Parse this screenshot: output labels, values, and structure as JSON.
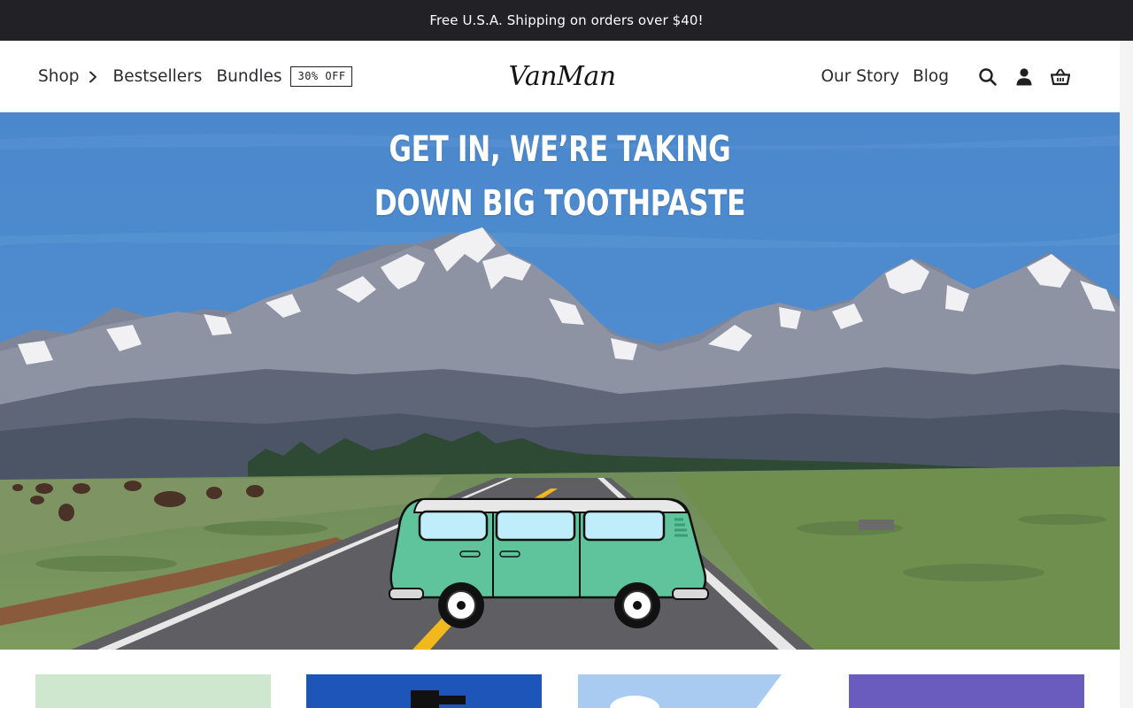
{
  "announcement": {
    "text": "Free U.S.A. Shipping on orders over $40!"
  },
  "header": {
    "logo_text": "VanMan",
    "nav_left": [
      {
        "label": "Shop",
        "has_chevron": true
      },
      {
        "label": "Bestsellers"
      },
      {
        "label": "Bundles"
      }
    ],
    "promo_badge": "30% OFF",
    "nav_right": [
      {
        "label": "Our Story"
      },
      {
        "label": "Blog"
      }
    ],
    "icons": [
      "search-icon",
      "account-icon",
      "cart-basket-icon"
    ]
  },
  "hero": {
    "headline_line1": "GET IN, WE’RE TAKING",
    "headline_line2": "DOWN BIG TOOTHPASTE"
  },
  "colors": {
    "announcement_bg": "#222226",
    "sky": "#4a86c9",
    "van": "#5fc49b",
    "badge_border": "#1f2024"
  }
}
